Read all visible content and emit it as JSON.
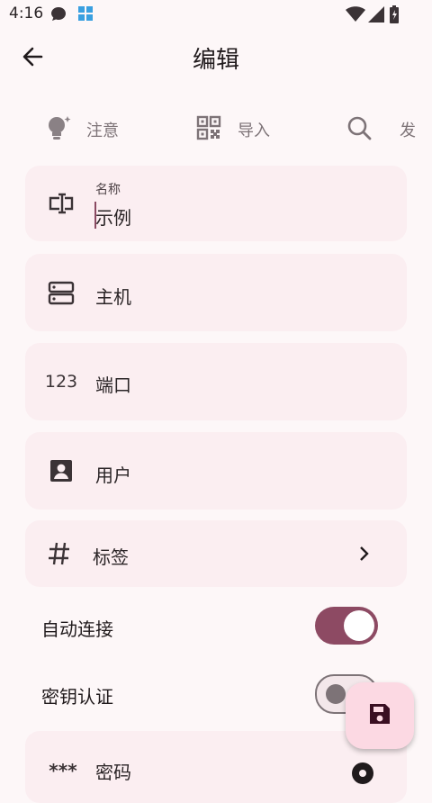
{
  "status_bar": {
    "time": "4:16"
  },
  "app_bar": {
    "title": "编辑"
  },
  "chips": [
    {
      "label": "注意",
      "icon": "lightbulb-icon"
    },
    {
      "label": "导入",
      "icon": "qr-code-icon"
    },
    {
      "label": "发",
      "icon": "search-icon"
    }
  ],
  "fields": {
    "name": {
      "label": "名称",
      "value": "示例"
    },
    "host": {
      "placeholder": "主机"
    },
    "port": {
      "icon_text": "123",
      "placeholder": "端口"
    },
    "user": {
      "placeholder": "用户"
    },
    "tags": {
      "label": "标签"
    },
    "password": {
      "icon_text": "***",
      "placeholder": "密码"
    }
  },
  "switches": {
    "auto_connect": {
      "label": "自动连接",
      "on": true
    },
    "key_auth": {
      "label": "密钥认证",
      "on": false
    }
  },
  "colors": {
    "accent": "#8d4a63",
    "card": "#fbeef1",
    "fab": "#fcd9e3",
    "background": "#fdf7f8"
  }
}
